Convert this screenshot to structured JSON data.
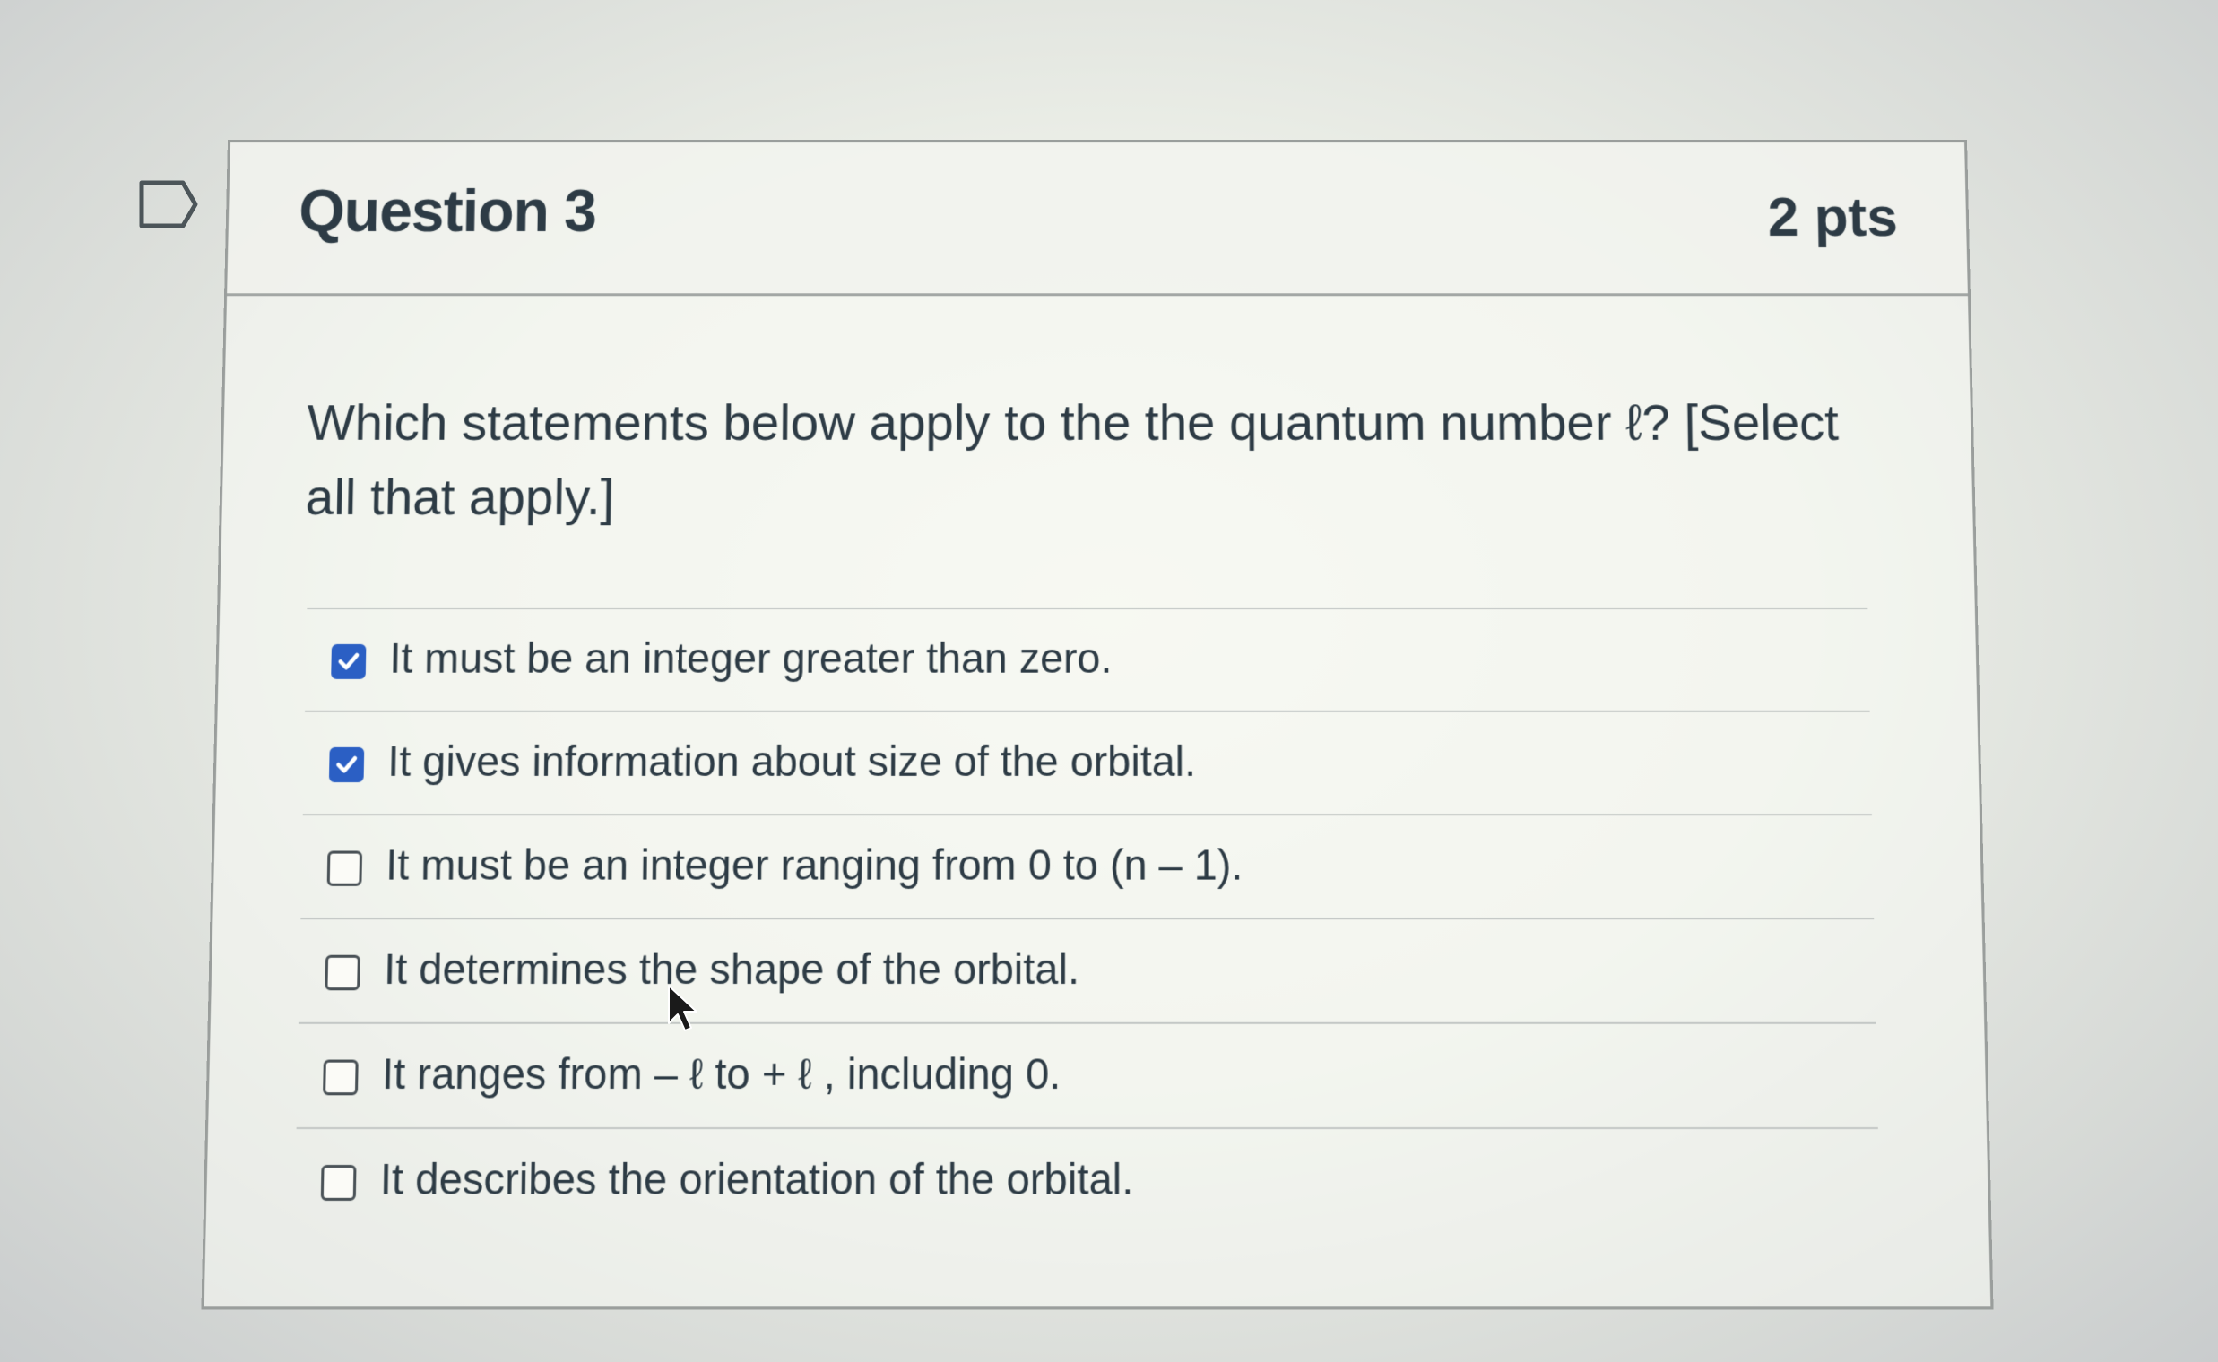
{
  "question": {
    "title": "Question 3",
    "points": "2 pts",
    "text": "Which statements below apply to the the quantum number ℓ? [Select all that apply.]"
  },
  "answers": [
    {
      "label": "It must be an integer greater than zero.",
      "checked": true
    },
    {
      "label": "It gives information about size of the orbital.",
      "checked": true
    },
    {
      "label": "It must be an integer ranging from 0 to (n – 1).",
      "checked": false
    },
    {
      "label": "It determines the shape of the orbital.",
      "checked": false
    },
    {
      "label": "It ranges from – ℓ to + ℓ , including 0.",
      "checked": false
    },
    {
      "label": "It describes the orientation of the orbital.",
      "checked": false
    }
  ],
  "colors": {
    "checkbox_checked": "#2b5fc4",
    "text": "#2d3b45",
    "border": "#9a9e9c"
  },
  "icons": {
    "flag": "flag-question-icon",
    "check": "checkmark-icon",
    "cursor": "mouse-pointer-icon"
  }
}
